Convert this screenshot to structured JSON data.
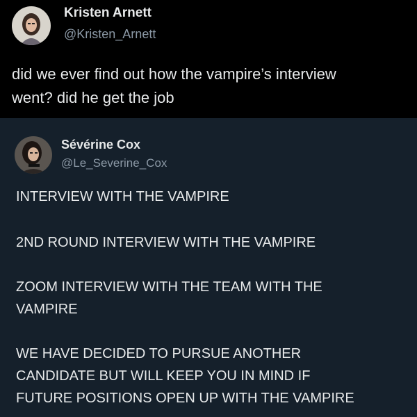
{
  "top_tweet": {
    "name": "Kristen Arnett",
    "handle": "@Kristen_Arnett",
    "lines": [
      "did we ever find out how the vampire’s interview",
      "went? did he get the job"
    ]
  },
  "quoted_tweet": {
    "name": "Sévérine Cox",
    "handle": "@Le_Severine_Cox",
    "paragraphs": [
      [
        "INTERVIEW WITH THE VAMPIRE"
      ],
      [
        "2ND ROUND INTERVIEW WITH THE VAMPIRE"
      ],
      [
        "ZOOM INTERVIEW WITH THE TEAM WITH THE",
        "VAMPIRE"
      ],
      [
        "WE HAVE DECIDED TO PURSUE ANOTHER",
        "CANDIDATE BUT WILL KEEP YOU IN MIND IF",
        "FUTURE POSITIONS OPEN UP WITH THE VAMPIRE"
      ]
    ]
  },
  "colors": {
    "top_background": "#000000",
    "bottom_background": "#15202b",
    "text": "#e7e9ea",
    "handle": "#8b98a5"
  }
}
